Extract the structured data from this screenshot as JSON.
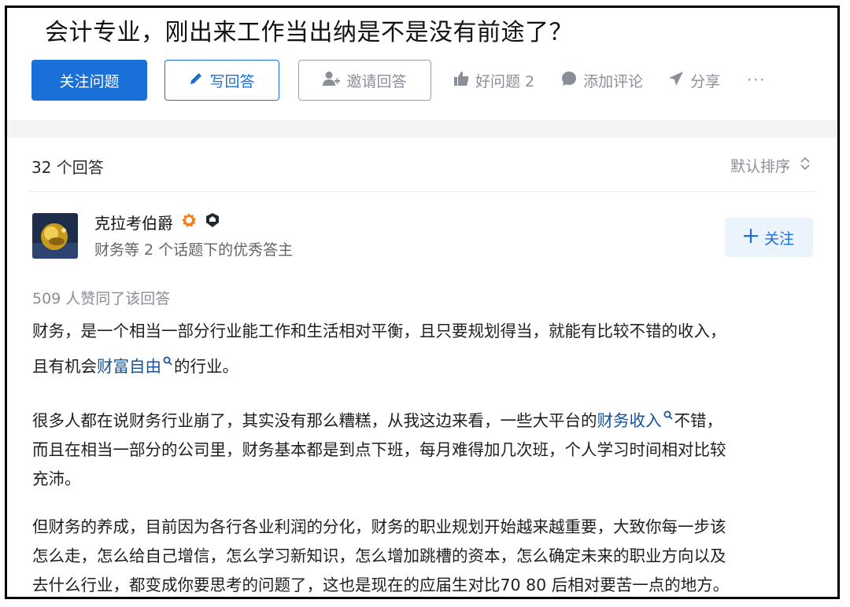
{
  "question": {
    "title": "会计专业，刚出来工作当出纳是不是没有前途了？"
  },
  "actions": {
    "follow_question": "关注问题",
    "write_answer": "写回答",
    "invite_answer": "邀请回答",
    "good_question": "好问题 2",
    "add_comment": "添加评论",
    "share": "分享",
    "more": "···"
  },
  "answers": {
    "count_label": "32 个回答",
    "sort_label": "默认排序"
  },
  "author": {
    "name": "克拉考伯爵",
    "bio": "财务等 2 个话题下的优秀答主",
    "follow_label": "关注"
  },
  "answer": {
    "votes": "509 人赞同了该回答",
    "p1_a": "财务，是一个相当一部分行业能工作和生活相对平衡，且只要规划得当，就能有比较不错的收入，",
    "p1_b": "且有机会",
    "p1_link": "财富自由",
    "p1_c": "的行业。",
    "p2_a": "很多人都在说财务行业崩了，其实没有那么糟糕，从我这边来看，一些大平台的",
    "p2_link": "财务收入",
    "p2_b": "不错，",
    "p2_c": "而且在相当一部分的公司里，财务基本都是到点下班，每月难得加几次班，个人学习时间相对比较",
    "p2_d": "充沛。",
    "p3_a": "但财务的养成，目前因为各行各业利润的分化，财务的职业规划开始越来越重要，大致你每一步该",
    "p3_b": "怎么走，怎么给自己增信，怎么学习新知识，怎么增加跳槽的资本，怎么确定未来的职业方向以及",
    "p3_c": "去什么行业，都变成你要思考的问题了，这也是现在的应届生对比70 80 后相对要苦一点的地方。"
  },
  "colors": {
    "primary": "#1a6fd9",
    "link": "#175199",
    "muted": "#8a8f97",
    "badge_orange": "#f0811a"
  }
}
